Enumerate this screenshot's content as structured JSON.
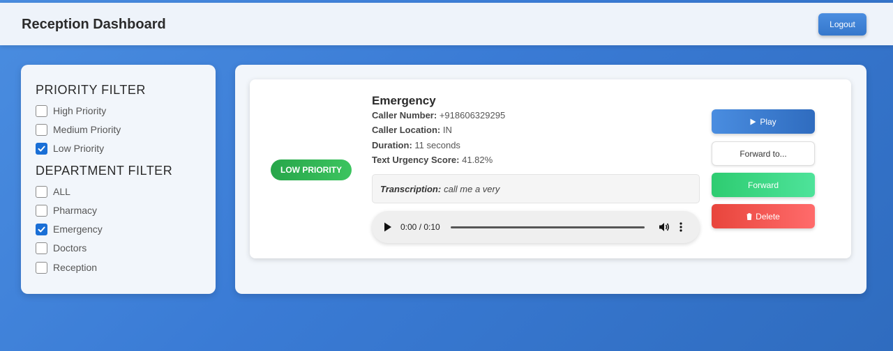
{
  "header": {
    "title": "Reception Dashboard",
    "logout_label": "Logout"
  },
  "filters": {
    "priority_heading": "PRIORITY FILTER",
    "priority_options": [
      {
        "label": "High Priority",
        "checked": false
      },
      {
        "label": "Medium Priority",
        "checked": false
      },
      {
        "label": "Low Priority",
        "checked": true
      }
    ],
    "department_heading": "DEPARTMENT FILTER",
    "department_options": [
      {
        "label": "ALL",
        "checked": false
      },
      {
        "label": "Pharmacy",
        "checked": false
      },
      {
        "label": "Emergency",
        "checked": true
      },
      {
        "label": "Doctors",
        "checked": false
      },
      {
        "label": "Reception",
        "checked": false
      }
    ]
  },
  "call": {
    "priority_badge": "LOW PRIORITY",
    "department": "Emergency",
    "caller_number_label": "Caller Number:",
    "caller_number": "+918606329295",
    "caller_location_label": "Caller Location:",
    "caller_location": "IN",
    "duration_label": "Duration:",
    "duration": "11 seconds",
    "urgency_label": "Text Urgency Score:",
    "urgency_score": "41.82%",
    "transcription_label": "Transcription:",
    "transcription": "call me a very",
    "audio_time": "0:00 / 0:10",
    "audio_progress": 0
  },
  "actions": {
    "play_label": "Play",
    "forward_to_label": "Forward to...",
    "forward_label": "Forward",
    "delete_label": "Delete"
  },
  "colors": {
    "accent": "#3a7bd5",
    "low_priority": "#2ea84f",
    "forward": "#2ecc71",
    "delete": "#e8453c",
    "checked": "#1a6fd6"
  },
  "icons": {
    "play": "play-triangle-icon",
    "delete": "trash-icon",
    "checkbox": "checkmark-icon",
    "volume": "volume-icon",
    "more": "more-vertical-icon"
  }
}
